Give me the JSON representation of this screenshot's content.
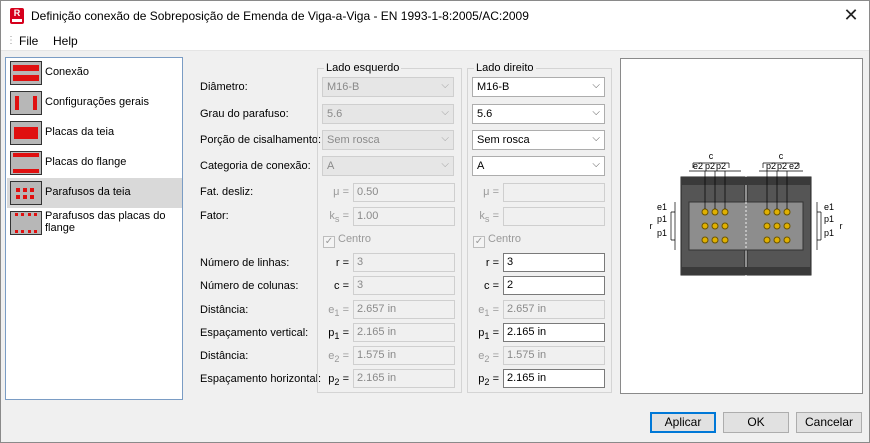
{
  "window": {
    "title": "Definição conexão de Sobreposição de Emenda de Viga-a-Viga - EN 1993-1-8:2005/AC:2009",
    "app_icon_letter": "R"
  },
  "menu": {
    "file": "File",
    "help": "Help"
  },
  "nav": {
    "items": [
      {
        "label": "Conexão"
      },
      {
        "label": "Configurações gerais"
      },
      {
        "label": "Placas da teia"
      },
      {
        "label": "Placas do flange"
      },
      {
        "label": "Parafusos da teia",
        "selected": true
      },
      {
        "label": "Parafusos das placas do flange"
      }
    ]
  },
  "groups": {
    "left": "Lado esquerdo",
    "right": "Lado direito"
  },
  "labels": {
    "diametro": "Diâmetro:",
    "grau": "Grau do parafuso:",
    "porcao": "Porção de cisalhamento:",
    "categoria": "Categoria de conexão:",
    "fat_desliz": "Fat. desliz:",
    "fator": "Fator:",
    "num_linhas": "Número de linhas:",
    "num_colunas": "Número de colunas:",
    "distancia1": "Distância:",
    "esp_vertical": "Espaçamento vertical:",
    "distancia2": "Distância:",
    "esp_horizontal": "Espaçamento horizontal:"
  },
  "symbols": {
    "mu": "μ =",
    "ks": "k",
    "ks_sub": "s",
    "r": "r =",
    "c": "c =",
    "e": "e",
    "p": "p",
    "sub1": "1",
    "sub2": "2",
    "eq": "="
  },
  "left": {
    "diametro": "M16-B",
    "grau": "5.6",
    "porcao": "Sem rosca",
    "categoria": "A",
    "fat_desliz": "0.50",
    "fator": "1.00",
    "centro": "Centro",
    "r": "3",
    "c": "3",
    "e1": "2.657 in",
    "p1": "2.165 in",
    "e2": "1.575 in",
    "p2": "2.165 in"
  },
  "right": {
    "diametro": "M16-B",
    "grau": "5.6",
    "porcao": "Sem rosca",
    "categoria": "A",
    "fat_desliz": "",
    "fator": "",
    "centro": "Centro",
    "r": "3",
    "c": "2",
    "e1": "2.657 in",
    "p1": "2.165 in",
    "e2": "1.575 in",
    "p2": "2.165 in"
  },
  "diagram": {
    "c": "c",
    "e2": "e2",
    "p2": "p2",
    "e1": "e1",
    "p1": "p1",
    "r": "r"
  },
  "buttons": {
    "apply": "Aplicar",
    "ok": "OK",
    "cancel": "Cancelar"
  },
  "colors": {
    "accent": "#0078d7",
    "bolt": "#e0b000",
    "steel": "#4a4a4a"
  }
}
